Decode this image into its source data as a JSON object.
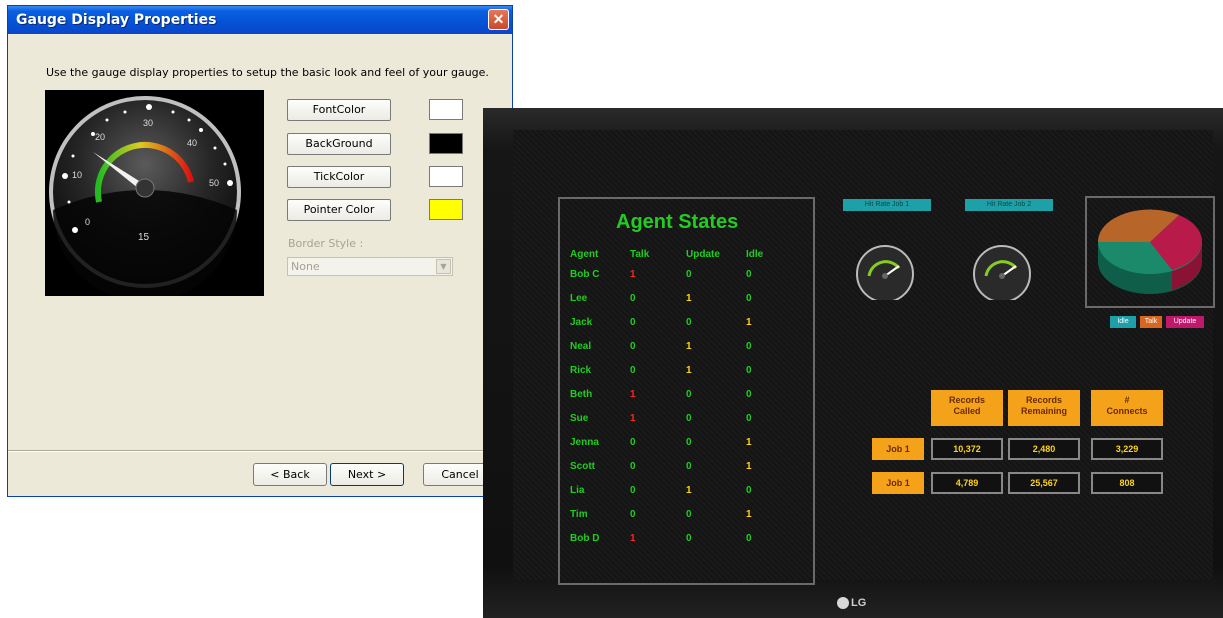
{
  "dialog": {
    "title": "Gauge Display Properties",
    "close_glyph": "✕",
    "instruction": "Use the gauge display  properties to setup the basic look and feel of your gauge.",
    "gauge_preview": {
      "ticks": [
        "0",
        "10",
        "20",
        "30",
        "40",
        "50"
      ],
      "center_value": "15",
      "colors": {
        "background": "#000000",
        "tick": "#ffffff",
        "pointer": "#ffffff"
      }
    },
    "properties": [
      {
        "label": "FontColor",
        "swatch": "#ffffff"
      },
      {
        "label": "BackGround",
        "swatch": "#000000"
      },
      {
        "label": "TickColor",
        "swatch": "#ffffff"
      },
      {
        "label": "Pointer Color",
        "swatch": "#ffff00"
      }
    ],
    "border_style": {
      "label": "Border Style :",
      "value": "None"
    },
    "buttons": {
      "back": "< Back",
      "next": "Next >",
      "cancel": "Cancel"
    }
  },
  "monitor": {
    "brand_bottom": "LG",
    "agent_states": {
      "title": "Agent States",
      "columns": [
        "Agent",
        "Talk",
        "Update",
        "Idle"
      ],
      "rows": [
        {
          "agent": "Bob C",
          "talk": "1",
          "update": "0",
          "idle": "0"
        },
        {
          "agent": "Lee",
          "talk": "0",
          "update": "1",
          "idle": "0"
        },
        {
          "agent": "Jack",
          "talk": "0",
          "update": "0",
          "idle": "1"
        },
        {
          "agent": "Neal",
          "talk": "0",
          "update": "1",
          "idle": "0"
        },
        {
          "agent": "Rick",
          "talk": "0",
          "update": "1",
          "idle": "0"
        },
        {
          "agent": "Beth",
          "talk": "1",
          "update": "0",
          "idle": "0"
        },
        {
          "agent": "Sue",
          "talk": "1",
          "update": "0",
          "idle": "0"
        },
        {
          "agent": "Jenna",
          "talk": "0",
          "update": "0",
          "idle": "1"
        },
        {
          "agent": "Scott",
          "talk": "0",
          "update": "0",
          "idle": "1"
        },
        {
          "agent": "Lia",
          "talk": "0",
          "update": "1",
          "idle": "0"
        },
        {
          "agent": "Tim",
          "talk": "0",
          "update": "0",
          "idle": "1"
        },
        {
          "agent": "Bob D",
          "talk": "1",
          "update": "0",
          "idle": "0"
        }
      ],
      "colors": {
        "label": "#22cc22",
        "active_talk": "#ff2222",
        "active_update": "#ffd21a",
        "active_idle": "#ffd21a",
        "zero": "#22cc22"
      }
    },
    "job_labels": [
      "Hit Rate Job 1",
      "Hit Rate Job 2"
    ],
    "pie_legend": [
      {
        "label": "Idle",
        "color": "#1ea0a8"
      },
      {
        "label": "Talk",
        "color": "#d8661e"
      },
      {
        "label": "Update",
        "color": "#c0186a"
      }
    ],
    "stats": {
      "headers": [
        "Records\nCalled",
        "Records\nRemaining",
        "#\nConnects"
      ],
      "rows": [
        {
          "job": "Job 1",
          "values": [
            "10,372",
            "2,480",
            "3,229"
          ]
        },
        {
          "job": "Job 1",
          "values": [
            "4,789",
            "25,567",
            "808"
          ]
        }
      ]
    }
  }
}
